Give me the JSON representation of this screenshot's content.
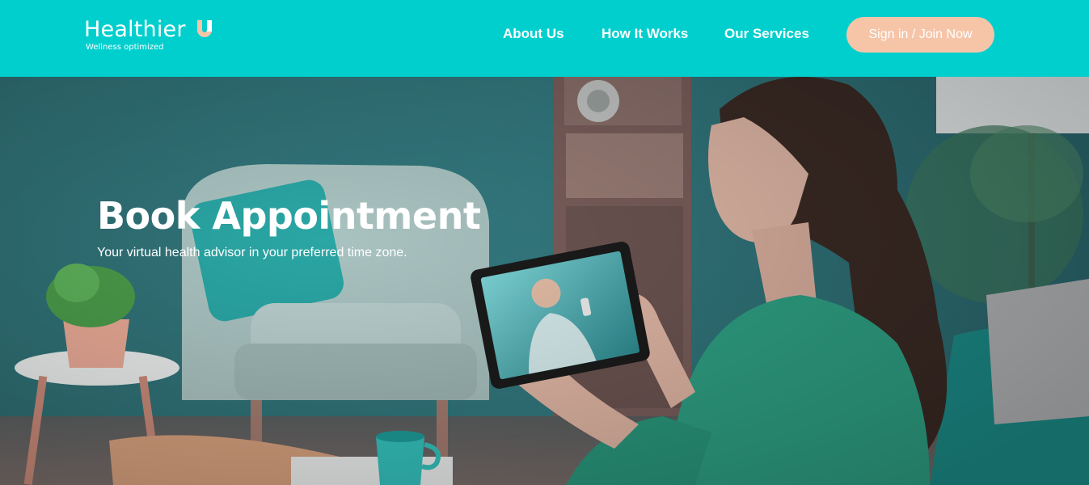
{
  "header": {
    "logo": {
      "name": "Healthier",
      "tagline": "Wellness optimized"
    },
    "nav": [
      {
        "label": "About Us"
      },
      {
        "label": "How It Works"
      },
      {
        "label": "Our Services"
      }
    ],
    "cta_label": "Sign in / Join Now"
  },
  "hero": {
    "title": "Book Appointment",
    "subtitle": "Your virtual health advisor in your preferred time zone."
  },
  "colors": {
    "header_bg": "#00cfce",
    "cta_bg": "#f6c5a8",
    "logo_accent": "#f6c5a8",
    "hero_text": "#ffffff"
  },
  "icons": [
    "healthier-u-logo-icon"
  ]
}
